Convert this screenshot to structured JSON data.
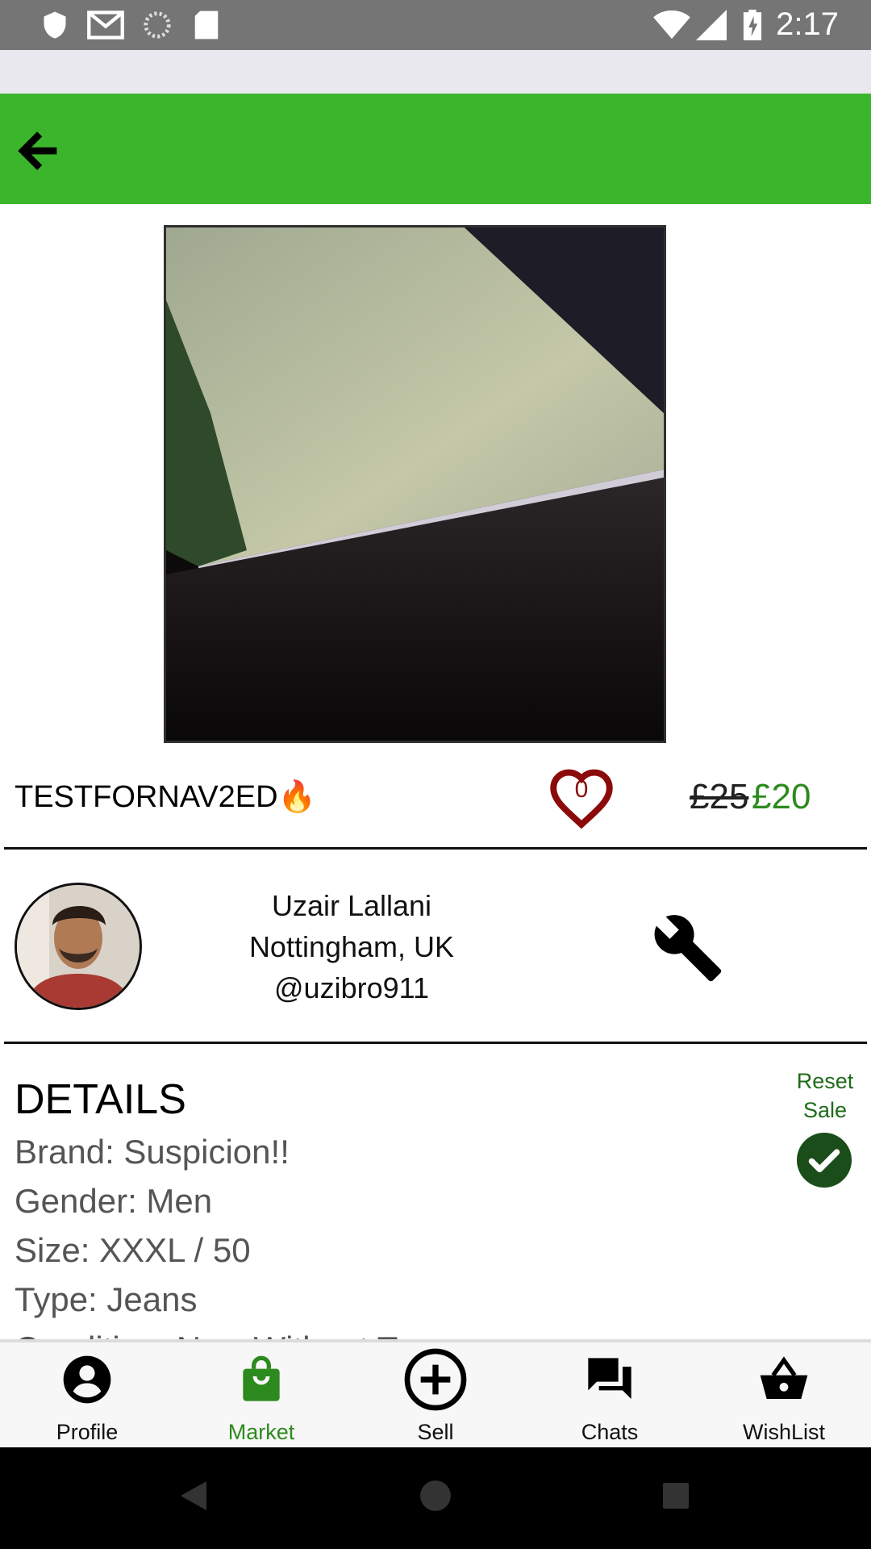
{
  "status_bar": {
    "time": "2:17"
  },
  "app_bar": {
    "back_icon": "arrow-left-icon",
    "color": "#3bb52c"
  },
  "product": {
    "title": "TESTFORNAV2ED",
    "title_emoji": "🔥",
    "likes": "0",
    "old_price": "£25",
    "new_price": "£20"
  },
  "seller": {
    "name": "Uzair Lallani",
    "location": "Nottingham, UK",
    "handle": "@uzibro911"
  },
  "details": {
    "heading": "DETAILS",
    "lines": [
      "Brand: Suspicion!!",
      "Gender: Men",
      "Size: XXXL / 50",
      "Type: Jeans",
      "Condition: New Without Tags"
    ],
    "reset_sale_label_1": "Reset",
    "reset_sale_label_2": "Sale"
  },
  "bottom_nav": {
    "items": [
      {
        "label": "Profile",
        "icon": "account-circle-icon"
      },
      {
        "label": "Market",
        "icon": "shopping-bag-icon",
        "active": true
      },
      {
        "label": "Sell",
        "icon": "plus-circle-icon"
      },
      {
        "label": "Chats",
        "icon": "chat-icon"
      },
      {
        "label": "WishList",
        "icon": "basket-icon"
      }
    ],
    "active_color": "#2d8a1e"
  }
}
